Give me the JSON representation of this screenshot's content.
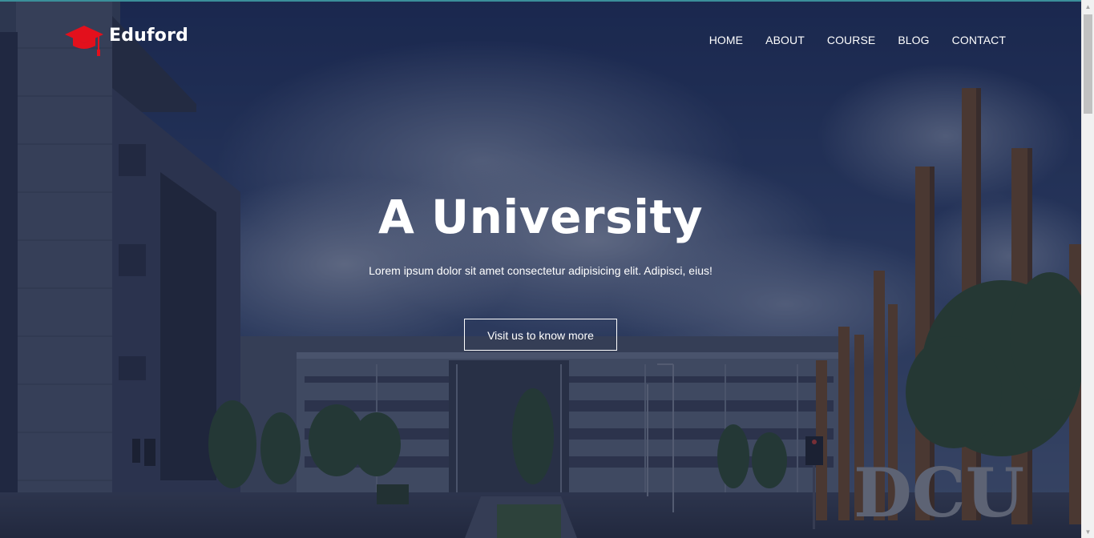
{
  "brand": {
    "name": "Eduford",
    "logo_icon": "graduation-cap-icon",
    "accent_color": "#e3101c"
  },
  "nav": {
    "items": [
      {
        "label": "HOME"
      },
      {
        "label": "ABOUT"
      },
      {
        "label": "COURSE"
      },
      {
        "label": "BLOG"
      },
      {
        "label": "CONTACT"
      }
    ]
  },
  "hero": {
    "title": "A University",
    "subtitle": "Lorem ipsum dolor sit amet consectetur adipisicing elit. Adipisci, eius!",
    "button_label": "Visit us to know more"
  },
  "background": {
    "sign_text": "DCU"
  },
  "scrollbar": {
    "up_icon": "triangle-up-icon",
    "down_icon": "triangle-down-icon"
  }
}
